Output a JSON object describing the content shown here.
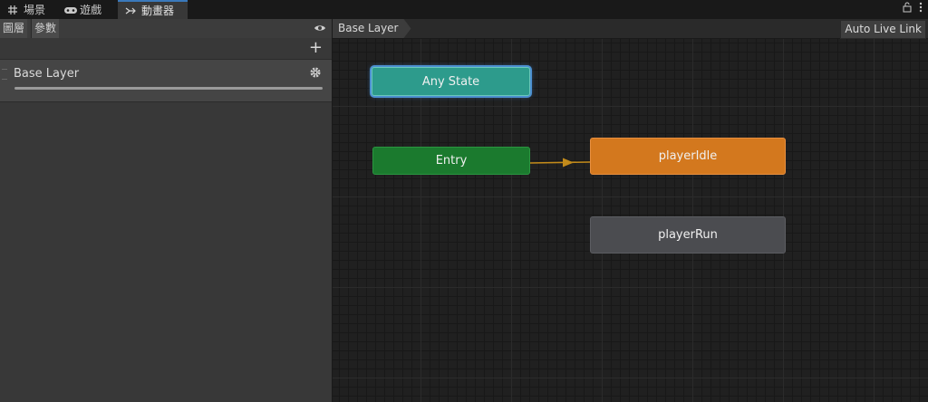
{
  "tabs": [
    {
      "label": "場景",
      "icon": "grid-icon"
    },
    {
      "label": "遊戲",
      "icon": "gamepad-icon"
    },
    {
      "label": "動畫器",
      "icon": "animator-icon",
      "active": true
    }
  ],
  "left_panel": {
    "subtabs": [
      "圖層",
      "參數"
    ],
    "add_label": "+",
    "layers": [
      {
        "name": "Base Layer"
      }
    ]
  },
  "graph": {
    "breadcrumb": "Base Layer",
    "live_link": "Auto Live Link",
    "states": {
      "any": "Any State",
      "entry": "Entry",
      "idle": "playerIdle",
      "run": "playerRun"
    }
  },
  "colors": {
    "any_state": "#2d9b8c",
    "entry": "#1b7a2e",
    "default_state": "#d3781e",
    "state": "#4b4c50",
    "transition": "#c28a1a",
    "active_tab_accent": "#3a79bb"
  }
}
